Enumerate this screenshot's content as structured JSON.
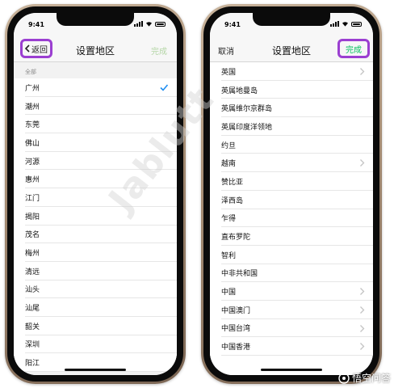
{
  "status": {
    "time": "9:41"
  },
  "left_screen": {
    "nav": {
      "title": "设置地区",
      "back_label": "返回",
      "done_label": "完成"
    },
    "section_header": "全部",
    "rows": [
      "广州",
      "潮州",
      "东莞",
      "佛山",
      "河源",
      "惠州",
      "江门",
      "揭阳",
      "茂名",
      "梅州",
      "清远",
      "汕头",
      "汕尾",
      "韶关",
      "深圳",
      "阳江"
    ],
    "selected_row": "广州"
  },
  "right_screen": {
    "nav": {
      "title": "设置地区",
      "cancel_label": "取消",
      "done_label": "完成"
    },
    "rows": [
      {
        "label": "英国",
        "chevron": true
      },
      {
        "label": "英属地曼岛",
        "chevron": false
      },
      {
        "label": "英属维尔京群岛",
        "chevron": false
      },
      {
        "label": "英属印度洋领地",
        "chevron": false
      },
      {
        "label": "约旦",
        "chevron": false
      },
      {
        "label": "越南",
        "chevron": true
      },
      {
        "label": "赞比亚",
        "chevron": false
      },
      {
        "label": "泽西岛",
        "chevron": false
      },
      {
        "label": "乍得",
        "chevron": false
      },
      {
        "label": "直布罗陀",
        "chevron": false
      },
      {
        "label": "智利",
        "chevron": false
      },
      {
        "label": "中非共和国",
        "chevron": false
      },
      {
        "label": "中国",
        "chevron": true
      },
      {
        "label": "中国澳门",
        "chevron": true
      },
      {
        "label": "中国台湾",
        "chevron": true
      },
      {
        "label": "中国香港",
        "chevron": true
      }
    ]
  },
  "watermark": "Jablutt",
  "footer": {
    "label": "悟空问答"
  },
  "colors": {
    "accent_green": "#07c160",
    "highlight_purple": "#9b3fd1",
    "checkmark_blue": "#1f8ef1"
  }
}
